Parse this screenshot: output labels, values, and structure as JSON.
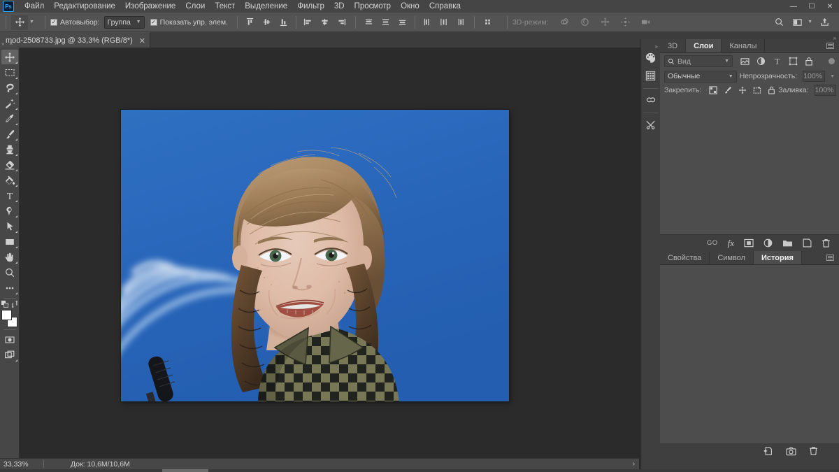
{
  "app": {
    "name": "Adobe Photoshop",
    "logo_text": "Ps"
  },
  "menubar": {
    "items": [
      "Файл",
      "Редактирование",
      "Изображение",
      "Слои",
      "Текст",
      "Выделение",
      "Фильтр",
      "3D",
      "Просмотр",
      "Окно",
      "Справка"
    ],
    "window_controls": {
      "minimize": "—",
      "maximize": "☐",
      "close": "✕"
    }
  },
  "options_bar": {
    "tool_icon": "move-tool-icon",
    "auto_select_label": "Автовыбор:",
    "auto_select_checked": true,
    "auto_select_value": "Группа",
    "show_controls_label": "Показать упр. элем.",
    "show_controls_checked": true,
    "align_icons": [
      "align-top-edges-icon",
      "align-vertical-centers-icon",
      "align-bottom-edges-icon",
      "align-left-edges-icon",
      "align-horizontal-centers-icon",
      "align-right-edges-icon"
    ],
    "distribute_icons": [
      "distribute-top-edges-icon",
      "distribute-vertical-centers-icon",
      "distribute-bottom-edges-icon",
      "distribute-left-edges-icon",
      "distribute-horizontal-centers-icon",
      "distribute-right-edges-icon"
    ],
    "more_align_icon": "align-more-options-icon",
    "threed_mode_label": "3D-режим:",
    "threed_icons": [
      "3d-orbit-icon",
      "3d-roll-icon",
      "3d-pan-icon",
      "3d-slide-icon",
      "3d-camera-icon"
    ],
    "right_icons": [
      "search-icon",
      "workspace-switcher-icon",
      "share-icon"
    ]
  },
  "document": {
    "tab_title": "mod-2508733.jpg @ 33,3% (RGB/8*)",
    "close_label": "✕"
  },
  "toolbar": {
    "tools": [
      {
        "name": "move-tool",
        "label": "Перемещение",
        "active": true,
        "has_flyout": true
      },
      {
        "name": "rectangular-marquee-tool",
        "label": "Прямоугольная область",
        "active": false,
        "has_flyout": true
      },
      {
        "name": "lasso-tool",
        "label": "Лассо",
        "active": false,
        "has_flyout": true
      },
      {
        "name": "magic-wand-tool",
        "label": "Волшебная палочка",
        "active": false,
        "has_flyout": true
      },
      {
        "name": "eyedropper-tool",
        "label": "Пипетка",
        "active": false,
        "has_flyout": true
      },
      {
        "name": "brush-tool",
        "label": "Кисть",
        "active": false,
        "has_flyout": true
      },
      {
        "name": "clone-stamp-tool",
        "label": "Штамп",
        "active": false,
        "has_flyout": true
      },
      {
        "name": "eraser-tool",
        "label": "Ластик",
        "active": false,
        "has_flyout": true
      },
      {
        "name": "paint-bucket-tool",
        "label": "Заливка",
        "active": false,
        "has_flyout": true
      },
      {
        "name": "type-tool",
        "label": "Текст",
        "active": false,
        "has_flyout": true
      },
      {
        "name": "pen-tool",
        "label": "Перо",
        "active": false,
        "has_flyout": true
      },
      {
        "name": "path-selection-tool",
        "label": "Выделение контура",
        "active": false,
        "has_flyout": true
      },
      {
        "name": "rectangle-tool",
        "label": "Прямоугольник",
        "active": false,
        "has_flyout": true
      },
      {
        "name": "hand-tool",
        "label": "Рука",
        "active": false,
        "has_flyout": true
      },
      {
        "name": "zoom-tool",
        "label": "Масштаб",
        "active": false,
        "has_flyout": false
      },
      {
        "name": "edit-toolbar-tool",
        "label": "Редактировать панель инструментов",
        "active": false,
        "has_flyout": true
      }
    ],
    "swap_colors_icon": "swap-colors-icon",
    "default_colors_icon": "default-colors-icon",
    "foreground_color": "#ffffff",
    "background_color": "#ffffff",
    "quick_mask_icon": "quick-mask-icon",
    "screen_mode_icon": "screen-mode-icon"
  },
  "canvas": {
    "image_alt": "Портрет девушки на синем фоне с логотипом Европейского парламента",
    "background_color": "#2a68bd",
    "zoom": "33,3%"
  },
  "status_bar": {
    "zoom": "33,33%",
    "doc_info": "Док: 10,6M/10,6M",
    "expand_arrow": "›"
  },
  "icon_dock": {
    "icons": [
      {
        "name": "color-panel-icon",
        "label": "Цвет"
      },
      {
        "name": "swatches-panel-icon",
        "label": "Образцы"
      },
      {
        "name": "creative-cloud-libraries-icon",
        "label": "Библиотеки"
      },
      {
        "name": "adjustments-panel-icon",
        "label": "Коррекция"
      }
    ]
  },
  "layers_panel": {
    "tabs": [
      {
        "name": "tab-3d",
        "label": "3D",
        "active": false
      },
      {
        "name": "tab-layers",
        "label": "Слои",
        "active": true
      },
      {
        "name": "tab-channels",
        "label": "Каналы",
        "active": false
      }
    ],
    "filter": {
      "search_icon": "search-icon",
      "value": "Вид",
      "type_icons": [
        "filter-pixel-icon",
        "filter-adjustment-icon",
        "filter-type-icon",
        "filter-shape-icon",
        "filter-smart-object-icon"
      ],
      "toggle_name": "filter-enable-toggle"
    },
    "blend_mode": "Обычные",
    "opacity_label": "Непрозрачность:",
    "opacity_value": "100%",
    "lock_label": "Закрепить:",
    "lock_icons": [
      "lock-transparent-pixels-icon",
      "lock-image-pixels-icon",
      "lock-position-icon",
      "lock-artboard-nesting-icon",
      "lock-all-icon"
    ],
    "fill_label": "Заливка:",
    "fill_value": "100%",
    "footer_icons": [
      {
        "name": "link-layers-icon",
        "label": "GO"
      },
      {
        "name": "layer-style-icon",
        "label": "fx"
      },
      {
        "name": "add-layer-mask-icon",
        "label": ""
      },
      {
        "name": "new-adjustment-layer-icon",
        "label": ""
      },
      {
        "name": "new-group-icon",
        "label": ""
      },
      {
        "name": "new-layer-icon",
        "label": ""
      },
      {
        "name": "delete-layer-icon",
        "label": ""
      }
    ]
  },
  "history_panel": {
    "tabs": [
      {
        "name": "tab-properties",
        "label": "Свойства",
        "active": false
      },
      {
        "name": "tab-character",
        "label": "Символ",
        "active": false
      },
      {
        "name": "tab-history",
        "label": "История",
        "active": true
      }
    ],
    "footer_icons": [
      {
        "name": "new-document-from-state-icon",
        "label": ""
      },
      {
        "name": "new-snapshot-icon",
        "label": ""
      },
      {
        "name": "delete-state-icon",
        "label": ""
      }
    ]
  }
}
